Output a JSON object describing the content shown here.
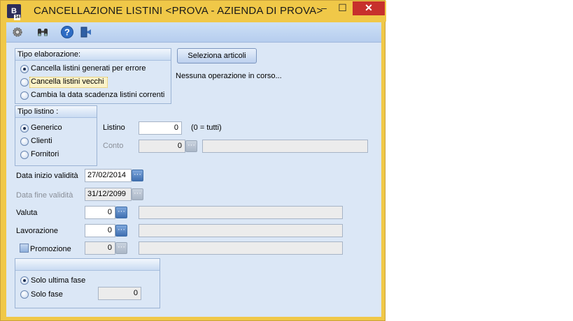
{
  "window": {
    "title": "CANCELLAZIONE LISTINI <PROVA - AZIENDA DI PROVA>",
    "app_icon_letter": "B",
    "app_icon_sub": "14",
    "minimize": "‒",
    "maximize": "☐",
    "close": "✕"
  },
  "toolbar": {
    "icons": [
      "gear-icon",
      "binoculars-icon",
      "help-icon",
      "exit-door-icon"
    ]
  },
  "tipo_elaborazione": {
    "title": "Tipo elaborazione:",
    "options": [
      {
        "label": "Cancella listini generati per errore",
        "selected": true
      },
      {
        "label": "Cancella listini vecchi",
        "selected": false
      },
      {
        "label": "Cambia la data scadenza listini correnti",
        "selected": false
      }
    ]
  },
  "seleziona_button": "Seleziona articoli",
  "status_text": "Nessuna operazione in corso...",
  "tipo_listino": {
    "title": "Tipo listino :",
    "options": [
      {
        "label": "Generico",
        "selected": true
      },
      {
        "label": "Clienti",
        "selected": false
      },
      {
        "label": "Fornitori",
        "selected": false
      }
    ]
  },
  "listino": {
    "label": "Listino",
    "value": "0",
    "hint": "(0 = tutti)"
  },
  "conto": {
    "label": "Conto",
    "value": "0",
    "description": ""
  },
  "data_inizio": {
    "label": "Data inizio validità",
    "value": "27/02/2014"
  },
  "data_fine": {
    "label": "Data fine validità",
    "value": "31/12/2099"
  },
  "valuta": {
    "label": "Valuta",
    "value": "0",
    "description": ""
  },
  "lavorazione": {
    "label": "Lavorazione",
    "value": "0",
    "description": ""
  },
  "promozione": {
    "label": "Promozione",
    "value": "0",
    "description": "",
    "checked": false
  },
  "fase": {
    "options": [
      {
        "label": "Solo ultima fase",
        "selected": true
      },
      {
        "label": "Solo fase",
        "selected": false
      }
    ],
    "solo_fase_value": "0"
  },
  "colors": {
    "titlebar": "#f0c848",
    "client": "#dbe7f6",
    "close": "#c7302c"
  }
}
